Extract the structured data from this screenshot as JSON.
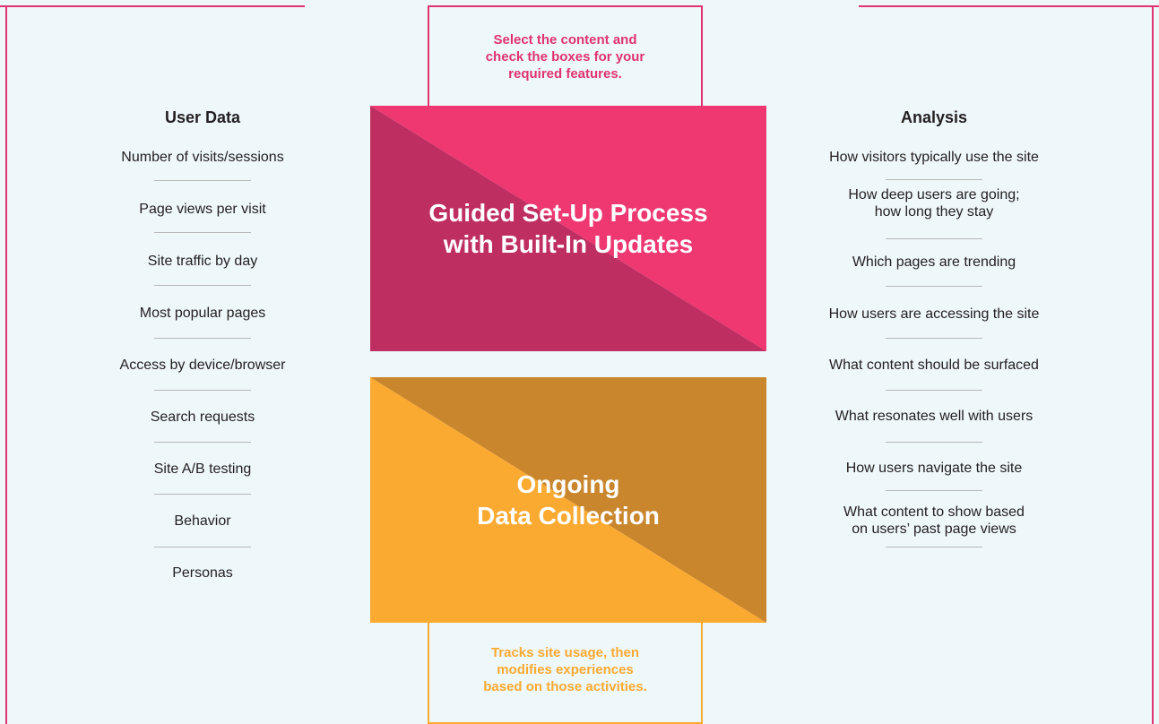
{
  "colors": {
    "background": "#eef7fa",
    "accent_pink": "#e0336f",
    "setup_light": "#ef3772",
    "setup_dark": "#bf2e61",
    "collection_light": "#fbaa31",
    "collection_dark": "#c9862d",
    "divider": "#b8b8b8"
  },
  "callouts": {
    "top": "Select the content and\ncheck the boxes for your\nrequired features.",
    "bottom": "Tracks site usage, then\nmodifies experiences\nbased on those activities."
  },
  "boxes": {
    "setup_title": "Guided Set-Up Process\nwith Built-In Updates",
    "collection_title": "Ongoing\nData Collection"
  },
  "user_data": {
    "heading": "User Data",
    "items": [
      "Number of visits/sessions",
      "Page views per visit",
      "Site traffic by day",
      "Most popular pages",
      "Access by device/browser",
      "Search requests",
      "Site A/B testing",
      "Behavior",
      "Personas"
    ]
  },
  "analysis": {
    "heading": "Analysis",
    "items": [
      "How visitors typically use the site",
      "How deep users are going;\nhow long they stay",
      "Which pages are trending",
      "How users are accessing the site",
      "What content should be surfaced",
      "What resonates well with users",
      "How users navigate the site",
      "What content to show based\non users’ past page views"
    ]
  }
}
